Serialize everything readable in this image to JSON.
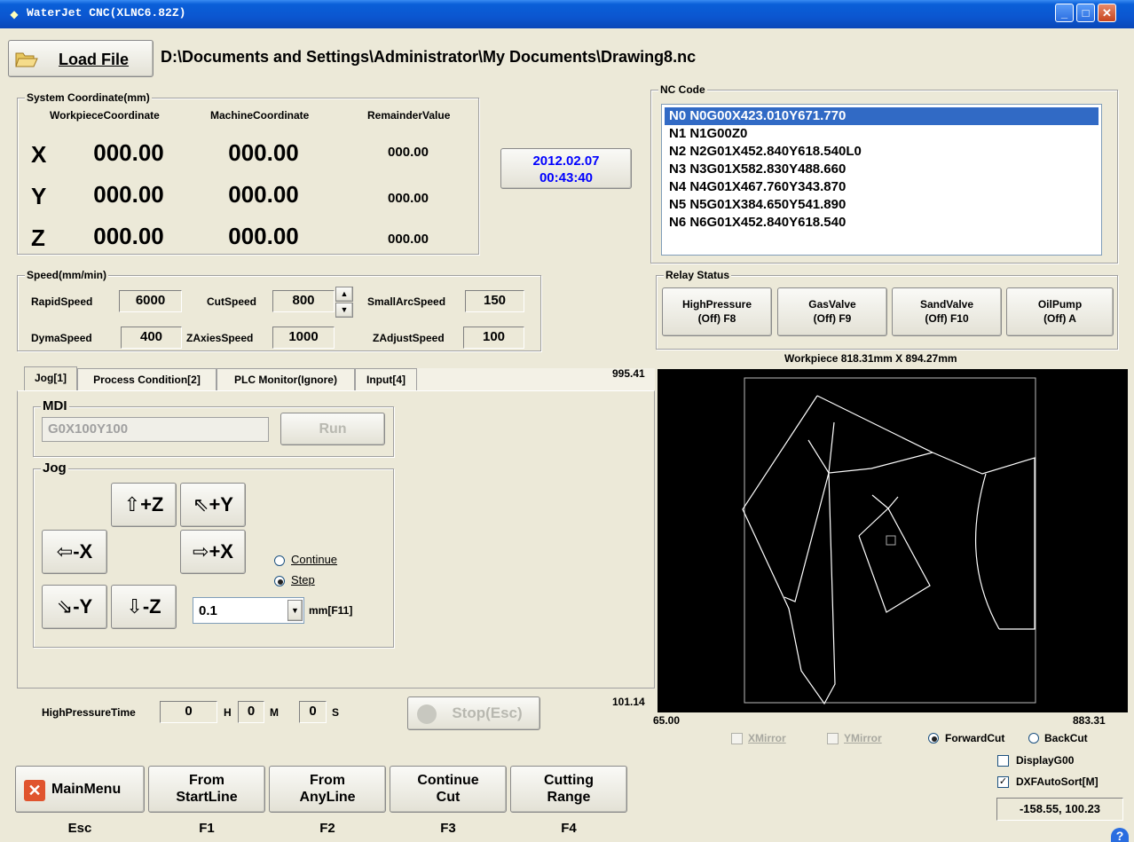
{
  "window": {
    "title": "WaterJet CNC(XLNC6.82Z)",
    "min": "_",
    "max": "□",
    "close": "✕"
  },
  "file": {
    "load_label": "Load File",
    "path": "D:\\Documents and Settings\\Administrator\\My Documents\\Drawing8.nc"
  },
  "sys_coord": {
    "legend": "System Coordinate(mm)",
    "headers": [
      "WorkpieceCoordinate",
      "MachineCoordinate",
      "RemainderValue"
    ],
    "axes": [
      {
        "label": "X",
        "work": "000.00",
        "machine": "000.00",
        "remainder": "000.00"
      },
      {
        "label": "Y",
        "work": "000.00",
        "machine": "000.00",
        "remainder": "000.00"
      },
      {
        "label": "Z",
        "work": "000.00",
        "machine": "000.00",
        "remainder": "000.00"
      }
    ]
  },
  "clock": {
    "date": "2012.02.07",
    "time": "00:43:40",
    "color": "#0000ff"
  },
  "speed": {
    "legend": "Speed(mm/min)",
    "rapid_label": "RapidSpeed",
    "rapid": "6000",
    "cut_label": "CutSpeed",
    "cut": "800",
    "smallarc_label": "SmallArcSpeed",
    "smallarc": "150",
    "dyma_label": "DymaSpeed",
    "dyma": "400",
    "zaxis_label": "ZAxiesSpeed",
    "zaxis": "1000",
    "zadjust_label": "ZAdjustSpeed",
    "zadjust": "100"
  },
  "nc": {
    "legend": "NC Code",
    "lines": [
      "N0 N0G00X423.010Y671.770",
      "N1 N1G00Z0",
      "N2 N2G01X452.840Y618.540L0",
      "N3 N3G01X582.830Y488.660",
      "N4 N4G01X467.760Y343.870",
      "N5 N5G01X384.650Y541.890",
      "N6 N6G01X452.840Y618.540"
    ]
  },
  "relay": {
    "legend": "Relay Status",
    "buttons": [
      {
        "l1": "HighPressure",
        "l2": "(Off) F8"
      },
      {
        "l1": "GasValve",
        "l2": "(Off) F9"
      },
      {
        "l1": "SandValve",
        "l2": "(Off) F10"
      },
      {
        "l1": "OilPump",
        "l2": "(Off) A"
      }
    ]
  },
  "workpiece": {
    "size": "Workpiece 818.31mm X 894.27mm",
    "ymax": "995.41",
    "ymin": "101.14",
    "xmin": "65.00",
    "xmax": "883.31"
  },
  "tabs": [
    "Jog[1]",
    "Process Condition[2]",
    "PLC Monitor(Ignore)",
    "Input[4]"
  ],
  "mdi": {
    "legend": "MDI",
    "value": "G0X100Y100",
    "run": "Run"
  },
  "jog": {
    "legend": "Jog",
    "zplus": "+Z",
    "yplus": "+Y",
    "xminus": "-X",
    "xplus": "+X",
    "yminus": "-Y",
    "zminus": "-Z",
    "continue": "Continue",
    "step": "Step",
    "step_value": "0.1",
    "unit": "mm[F11]"
  },
  "hp_time": {
    "label": "HighPressureTime",
    "h": "0",
    "h_lbl": "H",
    "m": "0",
    "m_lbl": "M",
    "s": "0",
    "s_lbl": "S"
  },
  "stop": "Stop(Esc)",
  "view_opts": {
    "xmirror": "XMirror",
    "ymirror": "YMirror",
    "forward": "ForwardCut",
    "back": "BackCut",
    "display_g00": "DisplayG00",
    "dxf_sort": "DXFAutoSort[M]",
    "cursor": "-158.55, 100.23"
  },
  "bottom": [
    {
      "l1": "MainMenu",
      "l2": "",
      "key": "Esc"
    },
    {
      "l1": "From",
      "l2": "StartLine",
      "key": "F1"
    },
    {
      "l1": "From",
      "l2": "AnyLine",
      "key": "F2"
    },
    {
      "l1": "Continue",
      "l2": "Cut",
      "key": "F3"
    },
    {
      "l1": "Cutting",
      "l2": "Range",
      "key": "F4"
    }
  ],
  "help": "?"
}
